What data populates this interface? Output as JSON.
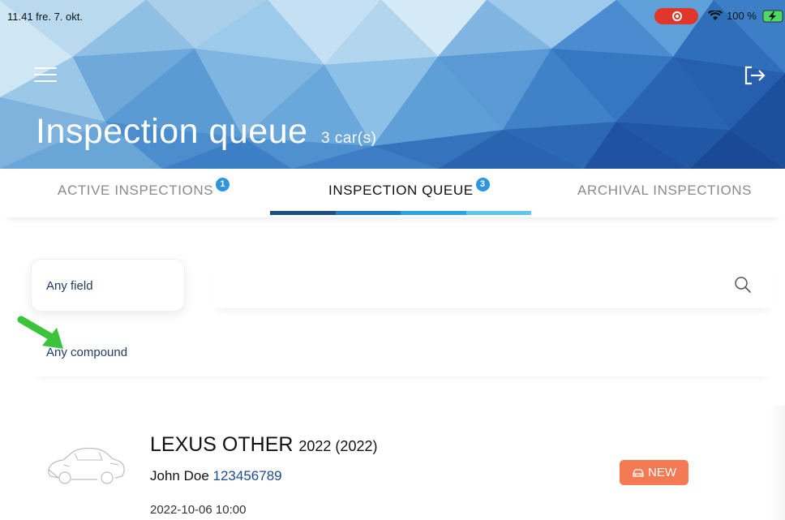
{
  "status_bar": {
    "time_date": "11.41  fre. 7. okt.",
    "battery_percent": "100 %"
  },
  "header": {
    "title": "Inspection queue",
    "car_count": "3 car(s)",
    "menu_icon": "hamburger-menu-icon",
    "logout_icon": "logout-icon"
  },
  "tabs": [
    {
      "label": "ACTIVE INSPECTIONS",
      "badge": "1",
      "active": false
    },
    {
      "label": "INSPECTION QUEUE",
      "badge": "3",
      "active": true
    },
    {
      "label": "ARCHIVAL INSPECTIONS",
      "badge": "",
      "active": false
    }
  ],
  "search": {
    "field_selector_label": "Any field",
    "input_value": "",
    "compound_filter_label": "Any compound",
    "search_icon": "search-icon"
  },
  "cars": [
    {
      "make_model": "LEXUS OTHER",
      "year_label": "2022 (2022)",
      "owner_name": "John Doe",
      "owner_phone": "123456789",
      "date": "2022-10-06 10:00",
      "status": "NEW"
    }
  ],
  "colors": {
    "accent_blue": "#2f95dc",
    "link_navy": "#1e3a5f",
    "status_new": "#f47a54",
    "annotation_arrow": "#3cc33c",
    "tab_indicator": [
      "#1b4f86",
      "#1f7fc4",
      "#2aa3e0",
      "#5fc7f0"
    ]
  }
}
